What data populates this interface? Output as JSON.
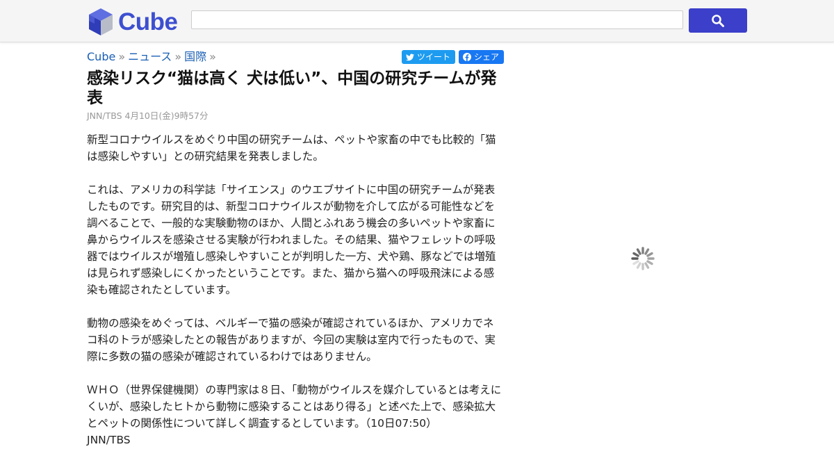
{
  "site": {
    "name": "Cube"
  },
  "search": {
    "value": "",
    "placeholder": ""
  },
  "breadcrumb": [
    "Cube",
    "ニュース",
    "国際"
  ],
  "breadcrumb_sep": "»",
  "share": {
    "tweet": "ツイート",
    "share": "シェア"
  },
  "article": {
    "title": "感染リスク“猫は高く 犬は低い”、中国の研究チームが発表",
    "meta": "JNN/TBS 4月10日(金)9時57分",
    "paragraphs": [
      "新型コロナウイルスをめぐり中国の研究チームは、ペットや家畜の中でも比較的「猫は感染しやすい」との研究結果を発表しました。",
      "これは、アメリカの科学誌「サイエンス」のウエブサイトに中国の研究チームが発表したものです。研究目的は、新型コロナウイルスが動物を介して広がる可能性などを調べることで、一般的な実験動物のほか、人間とふれあう機会の多いペットや家畜に鼻からウイルスを感染させる実験が行われました。その結果、猫やフェレットの呼吸器ではウイルスが増殖し感染しやすいことが判明した一方、犬や鶏、豚などでは増殖は見られず感染しにくかったということです。また、猫から猫への呼吸飛沫による感染も確認されたとしています。",
      "動物の感染をめぐっては、ベルギーで猫の感染が確認されているほか、アメリカでネコ科のトラが感染したとの報告がありますが、今回の実験は室内で行ったもので、実際に多数の猫の感染が確認されているわけではありません。",
      "ＷＨＯ（世界保健機関）の専門家は８日、「動物がウイルスを媒介しているとは考えにくいが、感染したヒトから動物に感染することはあり得る」と述べた上で、感染拡大とペットの関係性について詳しく調査するとしています。（10日07:50）",
      "JNN/TBS"
    ]
  },
  "colors": {
    "brand": "#3d4fd0",
    "search_button": "#3b3fc9",
    "link": "#1a5fb4",
    "twitter": "#1d9bf0",
    "facebook": "#1877f2"
  },
  "icons": {
    "logo": "cube-logo-icon",
    "search": "search-icon",
    "twitter": "twitter-bird-icon",
    "facebook": "facebook-icon",
    "loading": "loading-spinner-icon"
  }
}
